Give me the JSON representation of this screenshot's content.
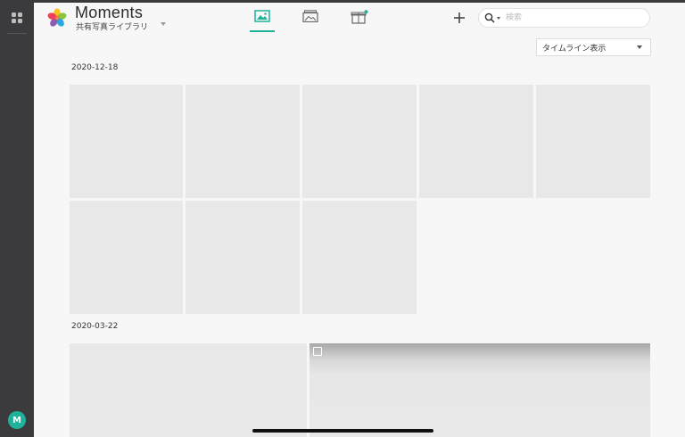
{
  "app": {
    "title": "Moments",
    "library_name": "共有写真ライブラリ"
  },
  "sidebar": {
    "avatar_initial": "M",
    "avatar_color": "#1fb29a"
  },
  "tabs": [
    {
      "name": "photos",
      "icon": "image-icon",
      "active": true
    },
    {
      "name": "albums",
      "icon": "albums-icon",
      "active": false
    },
    {
      "name": "gifts",
      "icon": "gift-icon",
      "active": false,
      "has_notification_dot": true
    }
  ],
  "toolbar": {
    "add_icon": "plus-icon",
    "search_placeholder": "検索",
    "search_value": ""
  },
  "view_mode": {
    "selected": "タイムライン表示"
  },
  "timeline": {
    "groups": [
      {
        "date": "2020-12-18",
        "item_count": 8
      },
      {
        "date": "2020-03-22",
        "item_count": 2
      }
    ]
  },
  "colors": {
    "accent": "#1fb29a",
    "rail": "#3b3b3d",
    "tile_placeholder": "#e8e8e8",
    "background": "#f7f7f7"
  }
}
